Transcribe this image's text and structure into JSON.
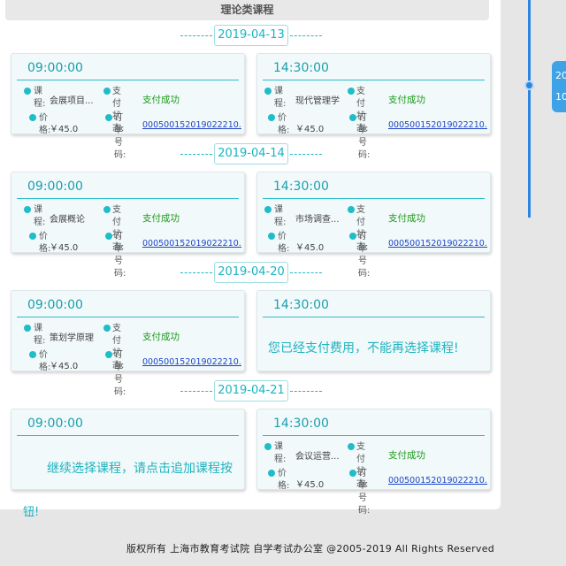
{
  "section_title": "理论类课程",
  "dates": [
    "2019-04-13",
    "2019-04-14",
    "2019-04-20",
    "2019-04-21"
  ],
  "field_labels": {
    "course": "课程:",
    "price": "价格:",
    "pay_status": "支付状态:",
    "order_no": "订单号码:"
  },
  "cards": {
    "c1": {
      "time": "09:00:00",
      "course": "会展项目...",
      "price": "￥45.0",
      "status": "支付成功",
      "order": "000500152019022210..."
    },
    "c2": {
      "time": "14:30:00",
      "course": "现代管理学",
      "price": "￥45.0",
      "status": "支付成功",
      "order": "000500152019022210..."
    },
    "c3": {
      "time": "09:00:00",
      "course": "会展概论",
      "price": "￥45.0",
      "status": "支付成功",
      "order": "000500152019022210..."
    },
    "c4": {
      "time": "14:30:00",
      "course": "市场调查...",
      "price": "￥45.0",
      "status": "支付成功",
      "order": "000500152019022210..."
    },
    "c5": {
      "time": "09:00:00",
      "course": "策划学原理",
      "price": "￥45.0",
      "status": "支付成功",
      "order": "000500152019022210..."
    },
    "c6": {
      "time": "14:30:00",
      "message": "您已经支付费用，不能再选择课程!"
    },
    "c7": {
      "time": "09:00:00",
      "message": "继续选择课程，请点击追加课程按",
      "message_overflow": "钮!"
    },
    "c8": {
      "time": "14:30:00",
      "course": "会议运营...",
      "price": "￥45.0",
      "status": "支付成功",
      "order": "000500152019022210..."
    }
  },
  "right_tab": {
    "line1": "20",
    "line2": "10"
  },
  "footer": "版权所有   上海市教育考试院 自学考试办公室   @2005-2019  All  Rights  Reserved",
  "colors": {
    "accent": "#1fb3bf",
    "status_green": "#1a9a1a",
    "link_blue": "#1a44c8",
    "timeline_blue": "#2a86e0"
  }
}
